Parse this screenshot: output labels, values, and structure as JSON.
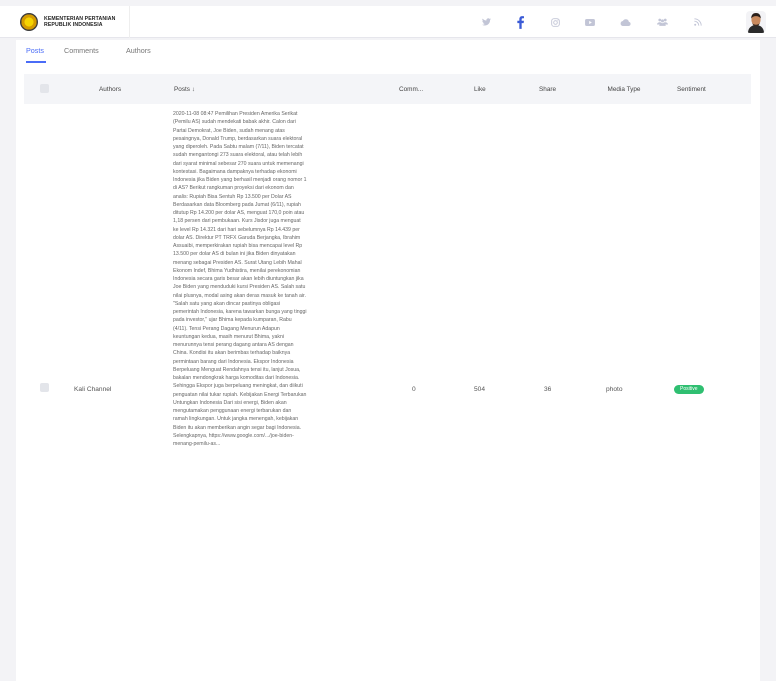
{
  "header": {
    "brand_line1": "KEMENTERIAN PERTANIAN",
    "brand_line2": "REPUBLIK INDONESIA",
    "social_icons": [
      "twitter-icon",
      "facebook-icon",
      "instagram-icon",
      "youtube-icon",
      "cloud-icon",
      "group-icon",
      "rss-icon"
    ],
    "accent_color": "#4a6cf7"
  },
  "tabs": [
    {
      "label": "Posts",
      "active": true
    },
    {
      "label": "Comments",
      "active": false
    },
    {
      "label": "Authors",
      "active": false
    }
  ],
  "table": {
    "columns": {
      "authors": "Authors",
      "posts": "Posts ↓",
      "comments": "Comm...",
      "like": "Like",
      "share": "Share",
      "media_type": "Media Type",
      "sentiment": "Sentiment"
    },
    "rows": [
      {
        "author": "Kali Channel",
        "post": "2020-11-08 08:47 Pemilihan Presiden Amerika Serikat (Pemilu AS) sudah mendekati babak akhir. Calon dari Partai Demokrat, Joe Biden, sudah menang atas pesaingnya, Donald Trump, berdasarkan suara elektoral yang diperoleh. Pada Sabtu malam (7/11), Biden tercatat sudah mengantongi 273 suara elektoral, atau telah lebih dari syarat minimal sebesar 270 suara untuk memenangi kontestasi. Bagaimana dampaknya terhadap ekonomi Indonesia jika Biden yang berhasil menjadi orang nomor 1 di AS? Berikut rangkuman proyeksi dari ekonom dan analis: Rupiah Bisa Sentuh Rp 13.500 per Dolar AS Berdasarkan data Bloomberg pada Jumat (6/11), rupiah ditutup Rp 14.200 per dolar AS, menguat 170,0 poin atau 1,18 persen dari pembukaan. Kurs Jisdor juga menguat ke level Rp 14.321 dari hari sebelumnya Rp 14.439 per dolar AS. Direktur PT TRFX Garuda Berjangka, Ibrahim Assuaibi, memperkirakan rupiah bisa mencapai level Rp 13.500 per dolar AS di bulan ini jika Biden dinyatakan menang sebagai Presiden AS. Surat Utang Lebih Mahal Ekonom Indef, Bhima Yudhistira, menilai perekonomian Indonesia secara garis besar akan lebih diuntungkan jika Joe Biden yang menduduki kursi Presiden AS. Salah satu nilai plusnya, modal asing akan deras masuk ke tanah air. \"Salah satu yang akan dincar pastinya obligasi pemerintah Indonesia, karena tawarkan bunga yang tinggi pada investor,\" ujar Bhima kepada kumparan, Rabu (4/11). Tensi Perang Dagang Menurun Adapun keuntungan kedua, masih menurut Bhima, yakni menurunnya tensi perang dagang antara AS dengan China. Kondisi itu akan berimbas terhadap baiknya permintaan barang dari Indonesia. Ekspor Indonesia Berpeluang Menguat Rendahnya tensi itu, lanjut Josua, bakalan mendongkrak harga komoditas dari Indonesia. Sehingga Ekspor juga berpeluang meningkat, dan diikuti penguatan nilai tukar rupiah. Kebijakan Energi Terbarukan Untungkan Indonesia Dari sisi energi, Biden akan mengutamakan penggunaan energi terbarukan dan ramah lingkungan. Untuk jangka menengah, kebijakan Biden itu akan memberikan angin segar bagi Indonesia. Selengkapnya, https://www.google.com/.../joe-biden-menang-pemilu-as...",
        "comments": "0",
        "like": "504",
        "share": "36",
        "media_type": "photo",
        "sentiment": "Positive",
        "sentiment_color": "#2fbf71"
      }
    ]
  }
}
